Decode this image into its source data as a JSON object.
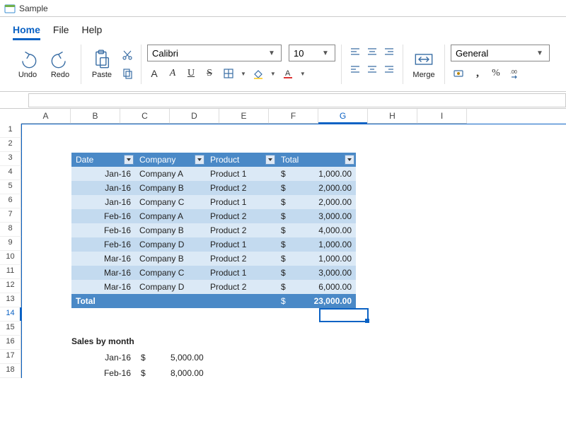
{
  "window": {
    "title": "Sample"
  },
  "menubar": {
    "home": "Home",
    "file": "File",
    "help": "Help"
  },
  "ribbon": {
    "undo": "Undo",
    "redo": "Redo",
    "paste": "Paste",
    "merge": "Merge",
    "font_name": "Calibri",
    "font_size": "10",
    "number_format": "General"
  },
  "columns": [
    "A",
    "B",
    "C",
    "D",
    "E",
    "F",
    "G",
    "H",
    "I"
  ],
  "rows": [
    "1",
    "2",
    "3",
    "4",
    "5",
    "6",
    "7",
    "8",
    "9",
    "10",
    "11",
    "12",
    "13",
    "14",
    "15",
    "16",
    "17",
    "18"
  ],
  "selected_col": "G",
  "selected_row": "14",
  "table": {
    "headers": {
      "date": "Date",
      "company": "Company",
      "product": "Product",
      "total": "Total"
    },
    "rows": [
      {
        "date": "Jan-16",
        "company": "Company A",
        "product": "Product 1",
        "total": "1,000.00"
      },
      {
        "date": "Jan-16",
        "company": "Company B",
        "product": "Product 2",
        "total": "2,000.00"
      },
      {
        "date": "Jan-16",
        "company": "Company C",
        "product": "Product 1",
        "total": "2,000.00"
      },
      {
        "date": "Feb-16",
        "company": "Company A",
        "product": "Product 2",
        "total": "3,000.00"
      },
      {
        "date": "Feb-16",
        "company": "Company B",
        "product": "Product 2",
        "total": "4,000.00"
      },
      {
        "date": "Feb-16",
        "company": "Company D",
        "product": "Product 1",
        "total": "1,000.00"
      },
      {
        "date": "Mar-16",
        "company": "Company B",
        "product": "Product 2",
        "total": "1,000.00"
      },
      {
        "date": "Mar-16",
        "company": "Company C",
        "product": "Product 1",
        "total": "3,000.00"
      },
      {
        "date": "Mar-16",
        "company": "Company D",
        "product": "Product 2",
        "total": "6,000.00"
      }
    ],
    "total_label": "Total",
    "grand_total": "23,000.00",
    "currency": "$"
  },
  "sales": {
    "title": "Sales by month",
    "rows": [
      {
        "date": "Jan-16",
        "value": "5,000.00"
      },
      {
        "date": "Feb-16",
        "value": "8,000.00"
      }
    ],
    "currency": "$"
  }
}
